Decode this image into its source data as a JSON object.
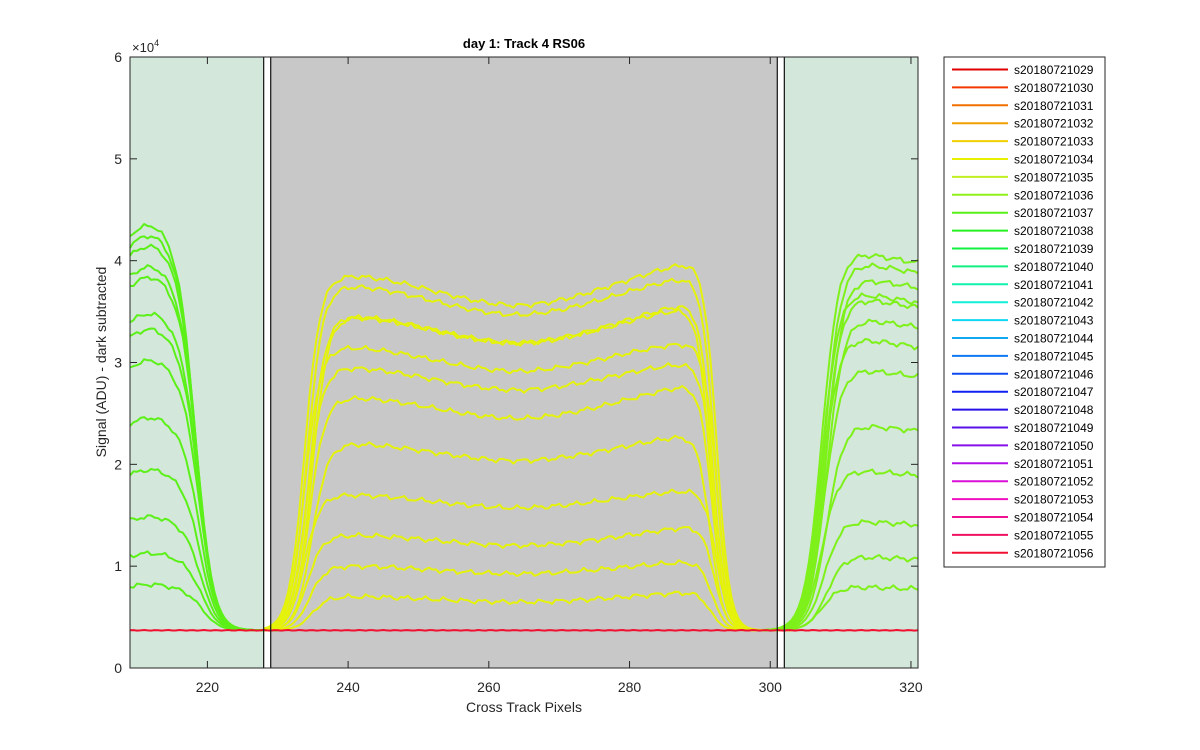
{
  "chart_data": {
    "type": "line",
    "title": "day 1: Track 4  RS06",
    "xlabel": "Cross Track Pixels",
    "ylabel": "Signal (ADU) - dark subtracted",
    "y_exponent_label": "×10",
    "y_exponent_power": "4",
    "xlim": [
      209,
      321
    ],
    "ylim": [
      0,
      60000
    ],
    "x_ticks": [
      220,
      240,
      260,
      280,
      300,
      320
    ],
    "x_tick_labels": [
      "220",
      "240",
      "260",
      "280",
      "300",
      "320"
    ],
    "y_ticks": [
      0,
      10000,
      20000,
      30000,
      40000,
      50000,
      60000
    ],
    "y_tick_labels": [
      "0",
      "1",
      "2",
      "3",
      "4",
      "5",
      "6"
    ],
    "grid": false,
    "legend_position": "outside-right",
    "background_color": "#ffffff",
    "regions": [
      {
        "x0": 209,
        "x1": 228,
        "color": "#d3e7da"
      },
      {
        "x0": 229,
        "x1": 301,
        "color": "#c8c8c8"
      },
      {
        "x0": 302,
        "x1": 321,
        "color": "#d3e7da"
      }
    ],
    "boundary_lines": [
      228,
      229,
      301,
      302
    ],
    "baseline": 3700,
    "segments": {
      "left": {
        "x_start": 209,
        "color": "#5cf019",
        "peak_levels": [
          42500,
          41500,
          40500,
          38500,
          37500,
          34000,
          32500,
          29500,
          24000,
          19000,
          14500,
          11000,
          8000
        ]
      },
      "center": {
        "color": "#e5f20a",
        "left_levels": [
          38500,
          37500,
          34500,
          34500,
          31500,
          29500,
          26500,
          22000,
          17000,
          13000,
          10000,
          7000
        ],
        "right_levels": [
          40000,
          38500,
          36000,
          35500,
          32000,
          30000,
          28000,
          23000,
          17500,
          14000,
          10500,
          7500
        ]
      },
      "right": {
        "x_end": 321,
        "color": "#7ef01a",
        "peak_levels": [
          41000,
          40000,
          38500,
          37000,
          36500,
          34500,
          32500,
          29500,
          24000,
          19500,
          14500,
          11000,
          8000
        ]
      }
    },
    "series": [
      {
        "name": "s20180721029",
        "color": "#e00000"
      },
      {
        "name": "s20180721030",
        "color": "#f03800"
      },
      {
        "name": "s20180721031",
        "color": "#f07000"
      },
      {
        "name": "s20180721032",
        "color": "#f0a000"
      },
      {
        "name": "s20180721033",
        "color": "#f0d000"
      },
      {
        "name": "s20180721034",
        "color": "#e8f000"
      },
      {
        "name": "s20180721035",
        "color": "#c0f020"
      },
      {
        "name": "s20180721036",
        "color": "#90f018"
      },
      {
        "name": "s20180721037",
        "color": "#58f018"
      },
      {
        "name": "s20180721038",
        "color": "#28f020"
      },
      {
        "name": "s20180721039",
        "color": "#10f040"
      },
      {
        "name": "s20180721040",
        "color": "#10f080"
      },
      {
        "name": "s20180721041",
        "color": "#10f0b0"
      },
      {
        "name": "s20180721042",
        "color": "#10f0d8"
      },
      {
        "name": "s20180721043",
        "color": "#10d8f0"
      },
      {
        "name": "s20180721044",
        "color": "#10a8f0"
      },
      {
        "name": "s20180721045",
        "color": "#1078f0"
      },
      {
        "name": "s20180721046",
        "color": "#1048f0"
      },
      {
        "name": "s20180721047",
        "color": "#1020f0"
      },
      {
        "name": "s20180721048",
        "color": "#2810e8"
      },
      {
        "name": "s20180721049",
        "color": "#5810e8"
      },
      {
        "name": "s20180721050",
        "color": "#8810e8"
      },
      {
        "name": "s20180721051",
        "color": "#b010e8"
      },
      {
        "name": "s20180721052",
        "color": "#d810d8"
      },
      {
        "name": "s20180721053",
        "color": "#f010c0"
      },
      {
        "name": "s20180721054",
        "color": "#f01090"
      },
      {
        "name": "s20180721055",
        "color": "#f01060"
      },
      {
        "name": "s20180721056",
        "color": "#f01030"
      }
    ]
  }
}
